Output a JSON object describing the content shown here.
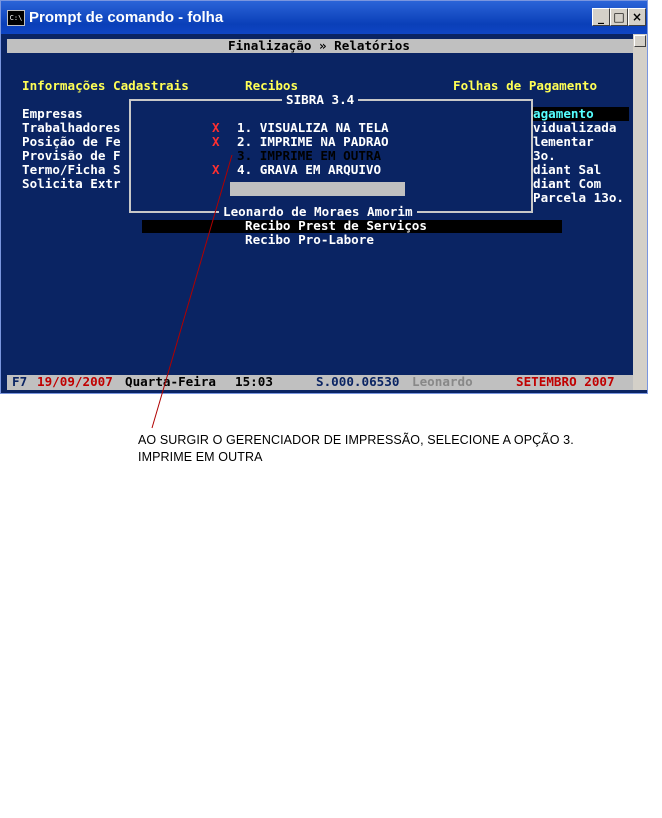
{
  "window": {
    "title": "Prompt de comando - folha",
    "icon": "C:\\",
    "buttons": {
      "minimize": "_",
      "maximize": "□",
      "close": "×"
    }
  },
  "header": {
    "title": "Finalização » Relatórios"
  },
  "menus": {
    "cadastrais": {
      "label": "Informações Cadastrais",
      "items": [
        "Empresas",
        "Trabalhadores",
        "Posição de Fe",
        "Provisão de F",
        "Termo/Ficha S",
        "Solicita Extr"
      ]
    },
    "recibos": {
      "label": "Recibos",
      "items": [
        "Recibo Prest de Serviços",
        "Recibo Pro-Labore"
      ]
    },
    "folhas": {
      "label": "Folhas de Pagamento",
      "items": [
        "agamento",
        "vidualizada",
        "lementar",
        "3o.",
        "diant Sal",
        "diant Com",
        "Parcela 13o."
      ]
    }
  },
  "dialog": {
    "title": "SIBRA 3.4",
    "marker": "X",
    "options": [
      "1. VISUALIZA NA TELA",
      "2. IMPRIME NA PADRAO",
      "3. IMPRIME EM OUTRA",
      "4. GRAVA EM ARQUIVO"
    ],
    "selected_index": 2,
    "footer": "Leonardo de Moraes Amorim"
  },
  "status_bar": {
    "key": "F7",
    "date": "19/09/2007",
    "weekday": "Quarta-Feira",
    "time": "15:03",
    "serial": "S.000.06530",
    "user": "Leonardo",
    "month": "SETEMBRO 2007"
  },
  "annotation": {
    "line1": "AO SURGIR O GERENCIADOR DE IMPRESSÃO, SELECIONE A OPÇÃO 3.",
    "line2": "IMPRIME EM OUTRA"
  },
  "colors": {
    "console_bg": "#0a2463",
    "menu_header": "#ffff55",
    "text": "#ffffff",
    "marker": "#ff3030",
    "highlight_cyan": "#55ffff",
    "status_date": "#c00000"
  }
}
